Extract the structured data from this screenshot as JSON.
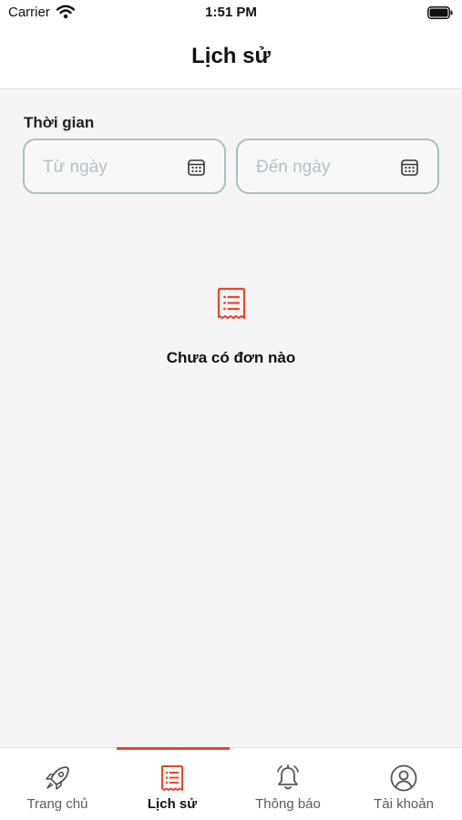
{
  "status_bar": {
    "carrier": "Carrier",
    "time": "1:51 PM"
  },
  "header": {
    "title": "Lịch sử"
  },
  "filter": {
    "label": "Thời gian",
    "from_placeholder": "Từ ngày",
    "to_placeholder": "Đến ngày"
  },
  "empty_state": {
    "message": "Chưa có đơn nào"
  },
  "tabs": [
    {
      "label": "Trang chủ",
      "icon": "rocket-icon",
      "active": false
    },
    {
      "label": "Lịch sử",
      "icon": "receipt-icon",
      "active": true
    },
    {
      "label": "Thông báo",
      "icon": "bell-icon",
      "active": false
    },
    {
      "label": "Tài khoản",
      "icon": "user-circle-icon",
      "active": false
    }
  ],
  "colors": {
    "accent": "#e8472c",
    "field_border": "#a9c2be",
    "background": "#f5f5f5"
  }
}
